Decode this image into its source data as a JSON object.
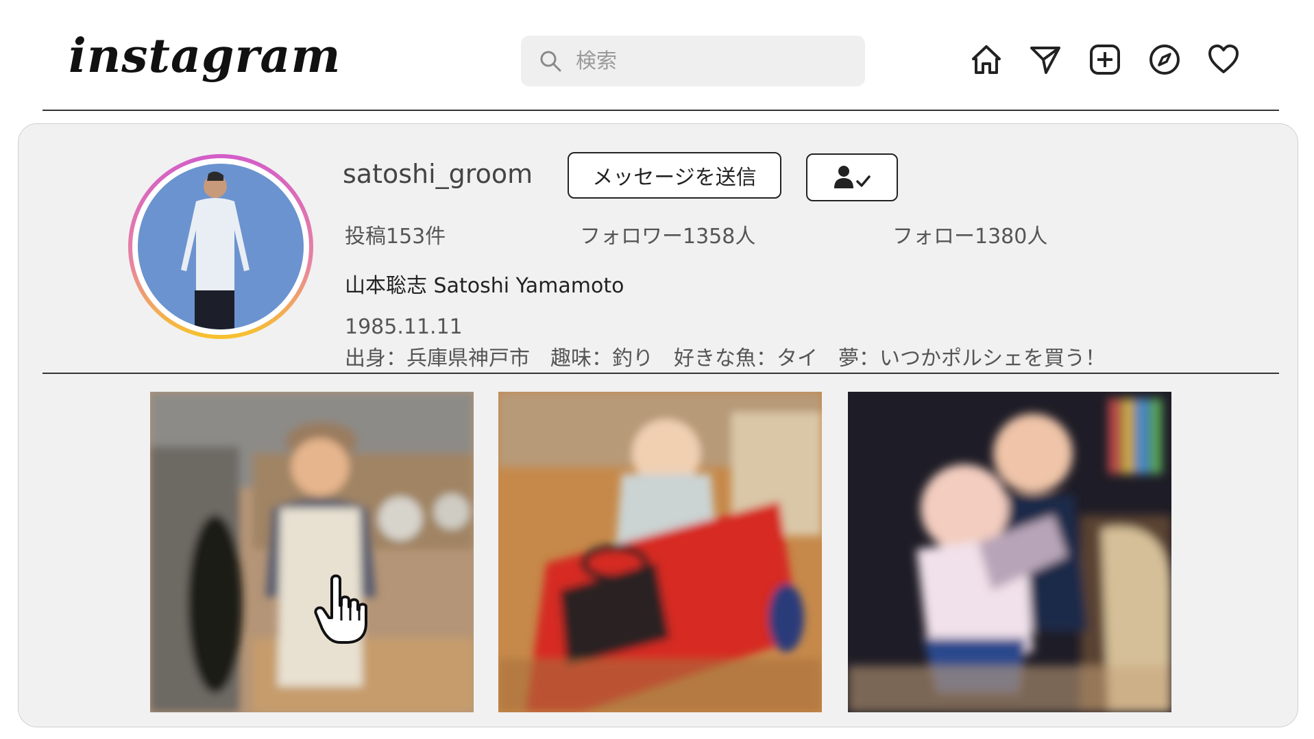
{
  "header": {
    "logo": "instagram",
    "search": {
      "placeholder": "検索",
      "value": ""
    },
    "nav_icons": [
      "home-icon",
      "send-icon",
      "add-post-icon",
      "explore-compass-icon",
      "heart-icon"
    ]
  },
  "profile": {
    "username": "satoshi_groom",
    "message_button": "メッセージを送信",
    "follow_status_icon": "person-check-icon",
    "stats": {
      "posts": "投稿153件",
      "followers": "フォロワー1358人",
      "following": "フォロー1380人"
    },
    "full_name": "山本聡志 Satoshi Yamamoto",
    "bio_line1": "1985.11.11",
    "bio_line2": "出身：兵庫県神戸市　趣味：釣り　好きな魚：タイ　夢：いつかポルシェを買う！"
  },
  "posts": [
    {
      "subject": "toddler in cap walking outdoors"
    },
    {
      "subject": "toddler in red toy car"
    },
    {
      "subject": "two children hugging"
    }
  ],
  "colors": {
    "card_bg": "#f1f1f1",
    "avatar_ring_start": "#d35ec8",
    "avatar_ring_end": "#f7c12e",
    "avatar_bg": "#6b93cf"
  }
}
